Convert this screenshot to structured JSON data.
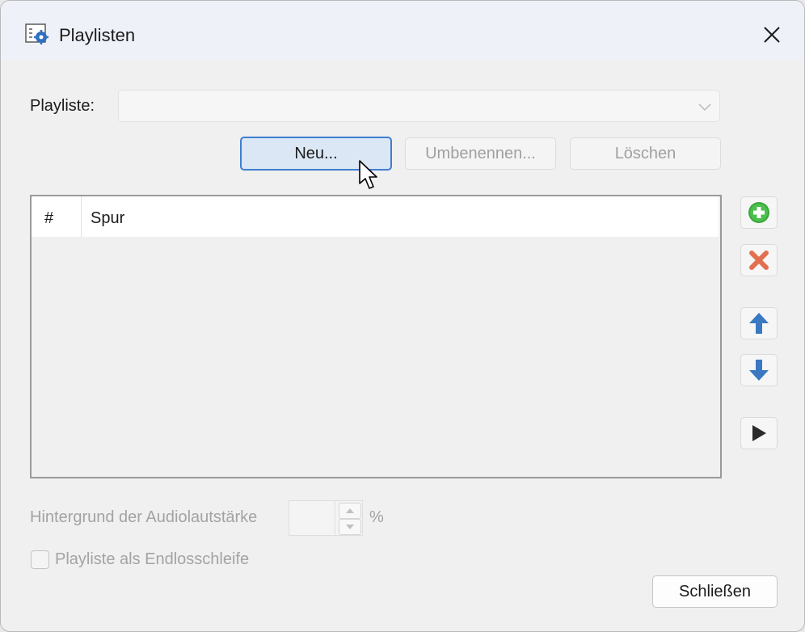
{
  "window": {
    "title": "Playlisten",
    "close_label": "×"
  },
  "playlist": {
    "label": "Playliste:",
    "selected_value": ""
  },
  "buttons": {
    "new": "Neu...",
    "rename": "Umbenennen...",
    "delete": "Löschen",
    "close": "Schließen"
  },
  "track_list": {
    "columns": [
      "#",
      "Spur"
    ],
    "rows": []
  },
  "side_tools": [
    "add-icon",
    "remove-icon",
    "move-up-icon",
    "move-down-icon",
    "play-icon"
  ],
  "volume": {
    "label": "Hintergrund der Audiolautstärke",
    "value": "",
    "unit": "%"
  },
  "loop": {
    "label": "Playliste als Endlosschleife",
    "checked": false
  },
  "colors": {
    "accent": "#3f7fd0",
    "add": "#3aa63a",
    "remove": "#e2704f",
    "arrow": "#3a78c2"
  }
}
